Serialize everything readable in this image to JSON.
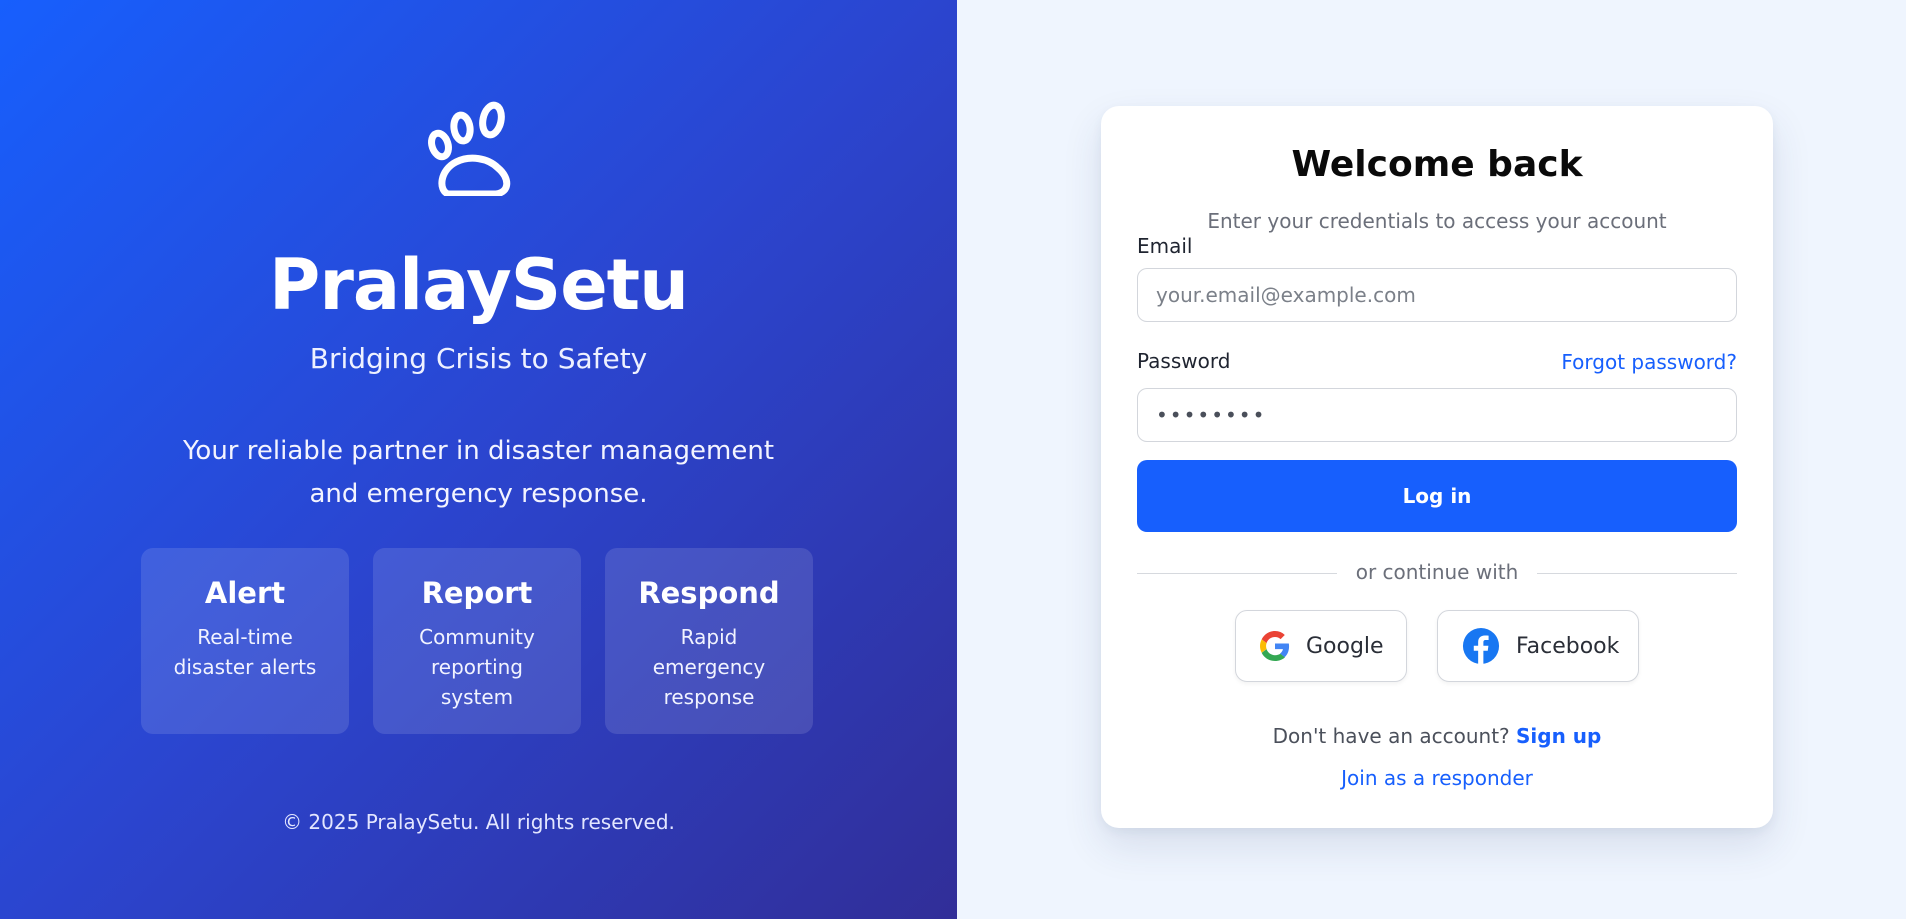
{
  "brand": {
    "logo_icon": "paw-icon",
    "name": "PralaySetu",
    "tagline": "Bridging Crisis to Safety",
    "description": "Your reliable partner in disaster management and emergency response.",
    "features": [
      {
        "title": "Alert",
        "description": "Real-time disaster alerts"
      },
      {
        "title": "Report",
        "description": "Community reporting system"
      },
      {
        "title": "Respond",
        "description": "Rapid emergency response"
      }
    ],
    "copyright": "© 2025 PralaySetu. All rights reserved.",
    "gradient_colors": [
      "#175ffd",
      "#2b45cf",
      "#312e98"
    ]
  },
  "login": {
    "title": "Welcome back",
    "subtitle": "Enter your credentials to access your account",
    "email_label": "Email",
    "email_placeholder": "your.email@example.com",
    "email_value": "",
    "password_label": "Password",
    "password_value": "••••••••",
    "forgot_password": "Forgot password?",
    "login_button": "Log in",
    "divider_text": "or continue with",
    "social": {
      "google_label": "Google",
      "google_icon": "google-icon",
      "facebook_label": "Facebook",
      "facebook_icon": "facebook-icon"
    },
    "signup_prompt": "Don't have an account?",
    "signup_link": "Sign up",
    "responder_link": "Join as a responder",
    "accent_color": "#175ffd"
  }
}
